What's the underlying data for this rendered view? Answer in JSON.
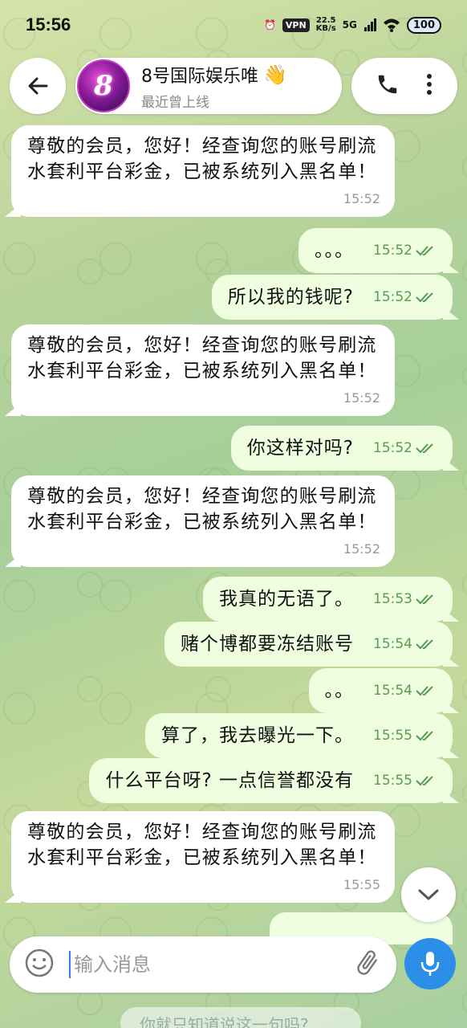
{
  "status_bar": {
    "time": "15:56",
    "vpn": "VPN",
    "speed_value": "22.5",
    "speed_unit": "KB/s",
    "network": "5G",
    "battery": "100"
  },
  "header": {
    "title": "8号国际娱乐唯",
    "subtitle": "最近曾上线",
    "avatar_text": "8",
    "wave": "👋"
  },
  "messages": [
    {
      "dir": "in",
      "text": "尊敬的会员，您好！经查询您的账号刷流水套利平台彩金，已被系统列入黑名单！",
      "time": "15:52"
    },
    {
      "dir": "out",
      "text": "。。。",
      "time": "15:52"
    },
    {
      "dir": "out",
      "text": "所以我的钱呢?",
      "time": "15:52"
    },
    {
      "dir": "in",
      "text": "尊敬的会员，您好！经查询您的账号刷流水套利平台彩金，已被系统列入黑名单！",
      "time": "15:52"
    },
    {
      "dir": "out",
      "text": "你这样对吗?",
      "time": "15:52"
    },
    {
      "dir": "in",
      "text": "尊敬的会员，您好！经查询您的账号刷流水套利平台彩金，已被系统列入黑名单！",
      "time": "15:52"
    },
    {
      "dir": "out",
      "text": "我真的无语了。",
      "time": "15:53"
    },
    {
      "dir": "out",
      "text": "赌个博都要冻结账号",
      "time": "15:54"
    },
    {
      "dir": "out",
      "text": "。。",
      "time": "15:54"
    },
    {
      "dir": "out",
      "text": "算了，我去曝光一下。",
      "time": "15:55"
    },
    {
      "dir": "out",
      "text": "什么平台呀? 一点信誉都没有",
      "time": "15:55"
    },
    {
      "dir": "in",
      "text": "尊敬的会员，您好！经查询您的账号刷流水套利平台彩金，已被系统列入黑名单！",
      "time": "15:55"
    }
  ],
  "composer": {
    "placeholder": "输入消息"
  },
  "partial_message": "你就只知道说这一句吗?",
  "colors": {
    "incoming": "#ffffff",
    "outgoing": "#eefedf",
    "accent": "#2b8fe8",
    "tick": "#5a9a52"
  }
}
